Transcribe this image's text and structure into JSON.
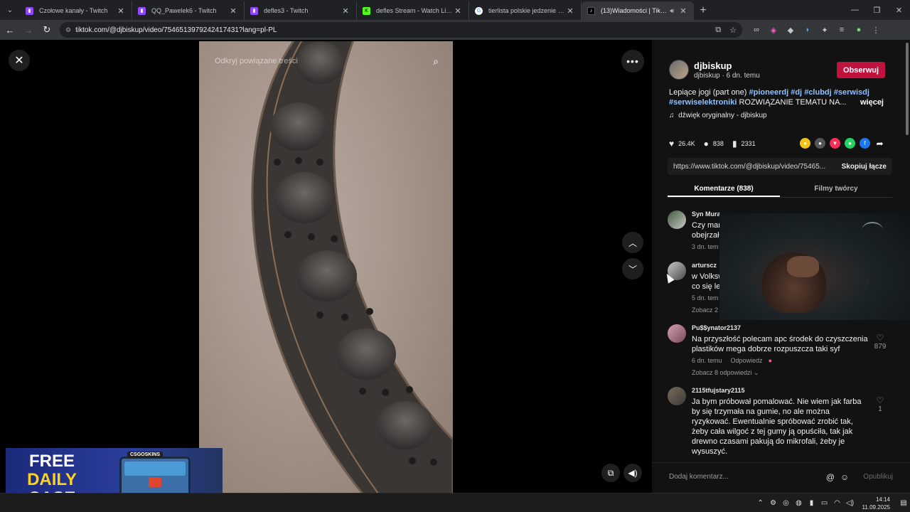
{
  "browser": {
    "tabs": [
      {
        "title": "Czołowe kanały - Twitch",
        "icon": "twitch-icon",
        "color": "#9146ff"
      },
      {
        "title": "QQ_Pawelek6 - Twitch",
        "icon": "twitch-icon",
        "color": "#9146ff"
      },
      {
        "title": "defles3 - Twitch",
        "icon": "twitch-icon",
        "color": "#9146ff"
      },
      {
        "title": "defles Stream - Watch Live on K",
        "icon": "kick-icon",
        "color": "#53fc18"
      },
      {
        "title": "tierlista polskie jedzenie - Szuk",
        "icon": "google-icon",
        "color": "#4285f4"
      },
      {
        "title": "(13)Wiadomości | TikTok",
        "icon": "tiktok-icon",
        "color": "#000000"
      }
    ],
    "url": "tiktok.com/@djbiskup/video/7546513979242417431?lang=pl-PL"
  },
  "video": {
    "search_placeholder": "Odkryj powiązane treści",
    "promo": {
      "line1": "FREE",
      "line2": "DAILY",
      "line3": "CASE",
      "chest_label": "CSGOSKINS"
    }
  },
  "post": {
    "author": "djbiskup",
    "author_sub": "djbiskup · 6 dn. temu",
    "follow_label": "Obserwuj",
    "description_text": "Lepiące jogi (part one)",
    "hashtags": [
      "#pioneerdj",
      "#dj",
      "#clubdj",
      "#serwisdj",
      "#serwiselektroniki"
    ],
    "description_tail": "ROZWIĄZANIE TEMATU NA...",
    "more_label": "więcej",
    "sound": "dźwięk oryginalny - djbiskup",
    "likes": "26.4K",
    "comments": "838",
    "saves": "2331",
    "share_colors": [
      "#f3c316",
      "#555555",
      "#fe2c55",
      "#25d366",
      "#1877f2"
    ],
    "link": "https://www.tiktok.com/@djbiskup/video/75465...",
    "copy_label": "Skopiuj łącze",
    "tab_comments": "Komentarze (838)",
    "tab_creator": "Filmy twórcy"
  },
  "comments": [
    {
      "name": "Syn Mura",
      "text": "Czy mar obejrzał",
      "meta": "3 dn. tem",
      "reply": "",
      "likes": ""
    },
    {
      "name": "arturscz",
      "text": "w Volksw co się le",
      "meta": "5 dn. tem",
      "reply": "Zobacz 2",
      "likes": ""
    },
    {
      "name": "Pu$$ynator2137",
      "text": "Na przyszłość polecam apc środek do czyszczenia plastików mega dobrze rozpuszcza taki syf",
      "meta": "6 dn. temu",
      "reply_label": "Odpowiedz",
      "reply": "Zobacz 8 odpowiedzi ⌄",
      "likes": "879"
    },
    {
      "name": "2115tfujstary2115",
      "text": "Ja bym próbował pomalować. Nie wiem jak farba by się trzymała na gumie, no ale można ryzykować. Ewentualnie spróbować zrobić tak, żeby cała wilgoć z tej gumy ją opuściła, tak jak drewno czasami pakują do mikrofali, żeby je wysuszyć.",
      "meta": "",
      "reply": "",
      "likes": "1"
    }
  ],
  "add_comment": {
    "placeholder": "Dodaj komentarz...",
    "publish": "Opublikuj"
  },
  "taskbar": {
    "time": "14:14",
    "date": "11.09.2025"
  }
}
